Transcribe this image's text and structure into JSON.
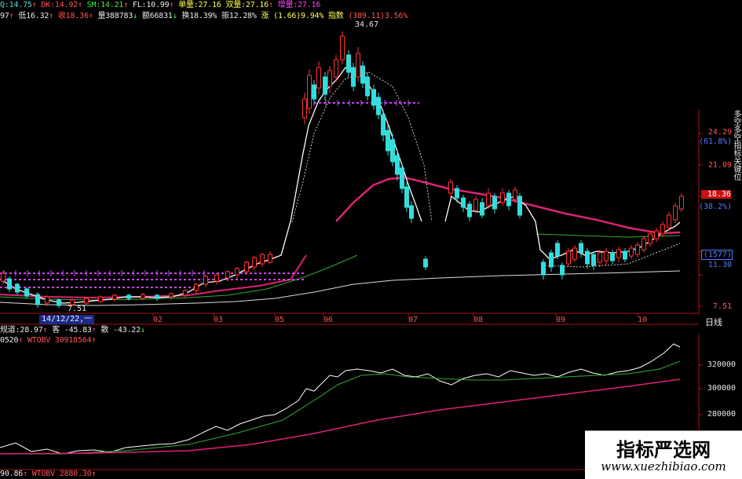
{
  "info_bar_1": [
    {
      "text": "Q:14.75",
      "color": "#55dddd"
    },
    {
      "text": "↑",
      "color": "#ff5555"
    },
    {
      "text": "DK:14.92",
      "color": "#ff5555"
    },
    {
      "text": "↑",
      "color": "#ff5555"
    },
    {
      "text": "SM:14.21",
      "color": "#44ee44"
    },
    {
      "text": "↑",
      "color": "#ff5555"
    },
    {
      "text": "FL:10.99",
      "color": "#e8e8e8"
    },
    {
      "text": "↑",
      "color": "#ff5555"
    },
    {
      "text": "单量:27.16",
      "color": "#ffff55"
    },
    {
      "text": "双量:27.16",
      "color": "#ffff55"
    },
    {
      "text": "↑",
      "color": "#ff5555"
    },
    {
      "text": "增量:27.16",
      "color": "#ff44ff"
    }
  ],
  "info_bar_2": [
    {
      "text": "97",
      "color": "#e8e8e8"
    },
    {
      "text": "↑",
      "color": "#ff5555"
    },
    {
      "text": "低16.32",
      "color": "#e8e8e8"
    },
    {
      "text": "↑",
      "color": "#ff5555"
    },
    {
      "text": "收18.36",
      "color": "#ff5555"
    },
    {
      "text": "↑",
      "color": "#ff5555"
    },
    {
      "text": "量388783",
      "color": "#e8e8e8"
    },
    {
      "text": "↓",
      "color": "#44ee44"
    },
    {
      "text": "额66831",
      "color": "#e8e8e8"
    },
    {
      "text": "↓",
      "color": "#44ee44"
    },
    {
      "text": "换18.39%",
      "color": "#e8e8e8"
    },
    {
      "text": "振12.28%",
      "color": "#e8e8e8"
    },
    {
      "text": "涨 (1.66)9.94%",
      "color": "#ffff55"
    },
    {
      "text": "指数",
      "color": "#ffff55"
    },
    {
      "text": "(389.11)3.56%",
      "color": "#ff5555"
    }
  ],
  "peak_label": "34.67",
  "low_label": "7.51",
  "price_axis": [
    {
      "text": "24.29",
      "color": "#ff5555"
    },
    {
      "text": "(61.8%)",
      "color": "#5577ff"
    },
    {
      "text": "21.09",
      "color": "#ff5555"
    },
    {
      "text": "18.36",
      "color": "#ffffff"
    },
    {
      "text": "(38.2%)",
      "color": "#5577ff"
    },
    {
      "text": "(1577)",
      "color": "#5577ff"
    },
    {
      "text": "11.30",
      "color": "#5577ff"
    },
    {
      "text": "7.51",
      "color": "#ff5555"
    }
  ],
  "months": [
    "02",
    "03",
    "05",
    "06",
    "07",
    "08",
    "09",
    "10"
  ],
  "date_box": "14/12/22,一",
  "period_label": "日线",
  "indicator_1": [
    {
      "text": "规道:28.97",
      "color": "#e8e8e8"
    },
    {
      "text": "↑",
      "color": "#ff5555"
    },
    {
      "text": "客 -45.83",
      "color": "#e8e8e8"
    },
    {
      "text": "↑",
      "color": "#ff5555"
    },
    {
      "text": "散 -43.22",
      "color": "#e8e8e8"
    },
    {
      "text": "↓",
      "color": "#44ee44"
    }
  ],
  "indicator_2": [
    {
      "text": "0520",
      "color": "#e8e8e8"
    },
    {
      "text": "↑",
      "color": "#ff5555"
    },
    {
      "text": "WTOBV 30918564",
      "color": "#ff5555"
    },
    {
      "text": "↑",
      "color": "#ff5555"
    }
  ],
  "indicator_3": [
    {
      "text": "90.86",
      "color": "#e8e8e8"
    },
    {
      "text": "↑",
      "color": "#ff5555"
    },
    {
      "text": "WTOBV 2880.30",
      "color": "#ff5555"
    },
    {
      "text": "↑",
      "color": "#ff5555"
    }
  ],
  "obv_axis": [
    "320000",
    "300000",
    "280000"
  ],
  "side_strip": "多空多空指标关键位",
  "watermark_title": "指标严选网",
  "watermark_url": "www.xuezhibiao.com",
  "colors": {
    "up": "#ff3333",
    "down": "#33dddd",
    "ma_pink": "#dd2277",
    "ma_green": "#33aa33",
    "mark": "#cc44ff",
    "line_white": "#ffffff",
    "grid_red": "#aa1111"
  }
}
